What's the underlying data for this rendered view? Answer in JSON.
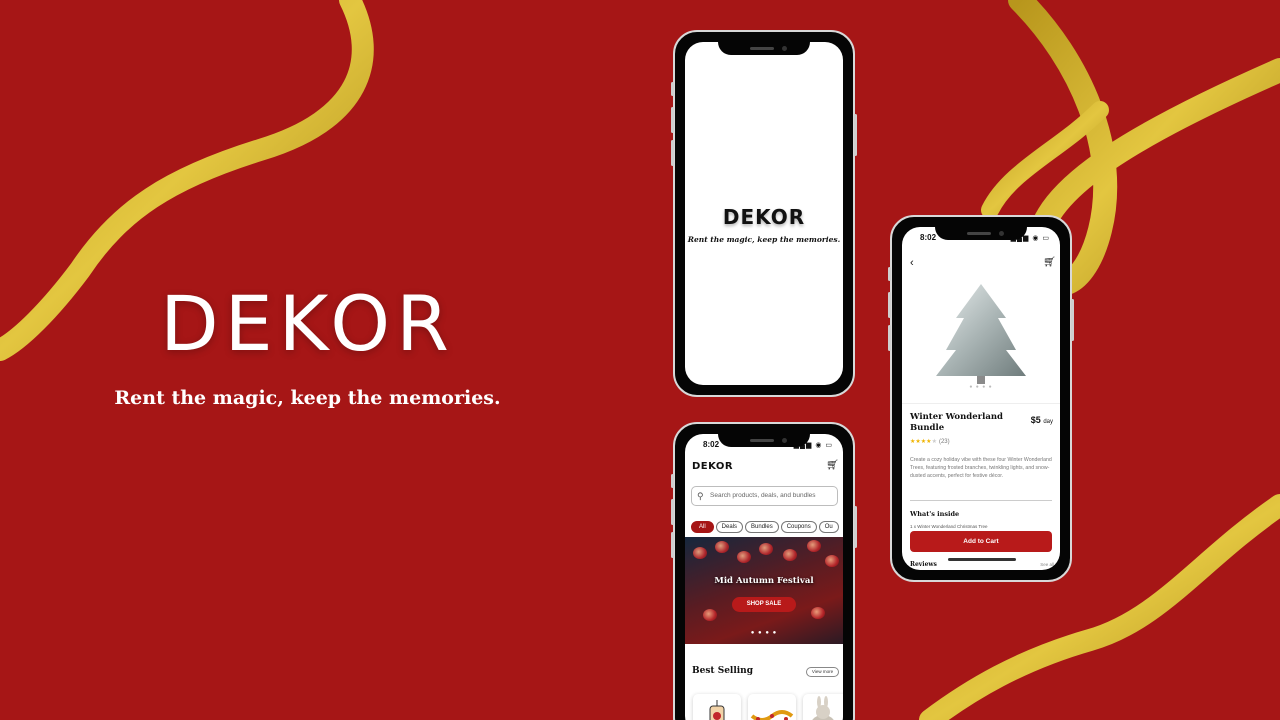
{
  "hero": {
    "title": "DEKOR",
    "tagline": "Rent the magic, keep the memories."
  },
  "colors": {
    "background": "#a61616",
    "ribbon": "#d4b42a",
    "accent": "#b81a1a"
  },
  "splash_screen": {
    "logo": "DEKOR",
    "tagline": "Rent the magic, keep the memories."
  },
  "home_screen": {
    "time": "8:02",
    "logo": "DEKOR",
    "cart_icon": "cart-icon",
    "search_placeholder": "Search products, deals, and bundles",
    "chips": [
      "All",
      "Deals",
      "Bundles",
      "Coupons",
      "Ou"
    ],
    "active_chip": "All",
    "banner": {
      "title": "Mid Autumn Festival",
      "button": "SHOP SALE",
      "dots": "● ● ● ●"
    },
    "section_title": "Best Selling",
    "view_more": "View more"
  },
  "product_screen": {
    "time": "8:02",
    "back_icon": "back-icon",
    "cart_icon": "cart-icon",
    "image_dots": "● ● ● ●",
    "name": "Winter Wonderland Bundle",
    "price": "$5",
    "price_unit": "day",
    "rating_stars": "★★★★★",
    "rating_value": 4,
    "rating_count": "(23)",
    "description": "Create a cozy holiday vibe with these four Winter Wonderland Trees, featuring frosted branches, twinkling lights, and snow-dusted accents, perfect for festive décor.",
    "whats_inside_title": "What's inside",
    "whats_inside_item": "1 x Winter Wonderland Christmas Tree",
    "add_to_cart": "Add to Cart",
    "reviews_title": "Reviews",
    "see_all": "See all"
  }
}
